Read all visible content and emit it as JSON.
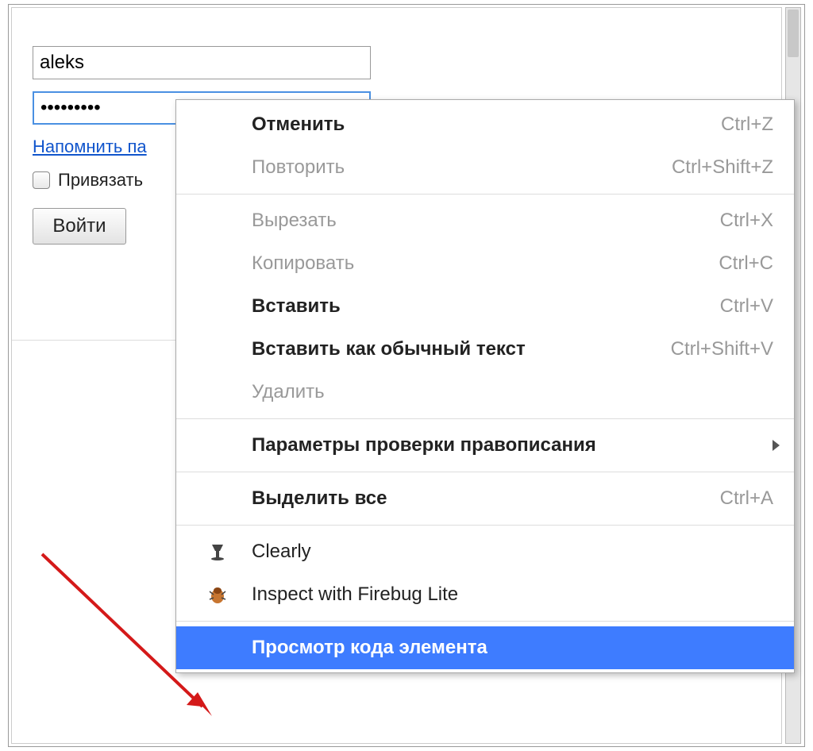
{
  "form": {
    "username_value": "aleks",
    "password_value": "•••••••••",
    "remind_link": "Напомнить па",
    "bind_label": "Привязать",
    "login_button": "Войти"
  },
  "context_menu": {
    "items": [
      {
        "label": "Отменить",
        "shortcut": "Ctrl+Z",
        "enabled": true,
        "bold": true
      },
      {
        "label": "Повторить",
        "shortcut": "Ctrl+Shift+Z",
        "enabled": false
      },
      {
        "separator": true
      },
      {
        "label": "Вырезать",
        "shortcut": "Ctrl+X",
        "enabled": false
      },
      {
        "label": "Копировать",
        "shortcut": "Ctrl+C",
        "enabled": false
      },
      {
        "label": "Вставить",
        "shortcut": "Ctrl+V",
        "enabled": true,
        "bold": true
      },
      {
        "label": "Вставить как обычный текст",
        "shortcut": "Ctrl+Shift+V",
        "enabled": true,
        "bold": true
      },
      {
        "label": "Удалить",
        "shortcut": "",
        "enabled": false
      },
      {
        "separator": true
      },
      {
        "label": "Параметры проверки правописания",
        "shortcut": "",
        "enabled": true,
        "bold": true,
        "submenu": true
      },
      {
        "separator": true
      },
      {
        "label": "Выделить все",
        "shortcut": "Ctrl+A",
        "enabled": true,
        "bold": true
      },
      {
        "separator": true
      },
      {
        "label": "Clearly",
        "shortcut": "",
        "enabled": true,
        "icon": "lamp"
      },
      {
        "label": "Inspect with Firebug Lite",
        "shortcut": "",
        "enabled": true,
        "icon": "firebug"
      },
      {
        "separator": true
      },
      {
        "label": "Просмотр кода элемента",
        "shortcut": "",
        "enabled": true,
        "highlighted": true,
        "bold": true
      }
    ]
  }
}
